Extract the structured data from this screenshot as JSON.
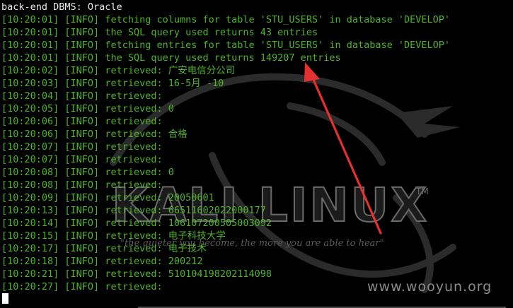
{
  "terminal": {
    "header": "back-end DBMS: Oracle",
    "lines": [
      {
        "ts": "[10:20:01]",
        "level": "[INFO]",
        "msg": "fetching columns for table 'STU_USERS' in database 'DEVELOP'"
      },
      {
        "ts": "[10:20:01]",
        "level": "[INFO]",
        "msg": "the SQL query used returns 43 entries"
      },
      {
        "ts": "[10:20:01]",
        "level": "[INFO]",
        "msg": "fetching entries for table 'STU_USERS' in database 'DEVELOP'"
      },
      {
        "ts": "[10:20:01]",
        "level": "[INFO]",
        "msg": "the SQL query used returns 149207 entries"
      },
      {
        "ts": "[10:20:02]",
        "level": "[INFO]",
        "msg": "retrieved: 广安电信分公司"
      },
      {
        "ts": "[10:20:03]",
        "level": "[INFO]",
        "msg": "retrieved: 16-5月 -10"
      },
      {
        "ts": "[10:20:04]",
        "level": "[INFO]",
        "msg": "retrieved:"
      },
      {
        "ts": "[10:20:05]",
        "level": "[INFO]",
        "msg": "retrieved: 0"
      },
      {
        "ts": "[10:20:06]",
        "level": "[INFO]",
        "msg": "retrieved:"
      },
      {
        "ts": "[10:20:06]",
        "level": "[INFO]",
        "msg": "retrieved: 合格"
      },
      {
        "ts": "[10:20:07]",
        "level": "[INFO]",
        "msg": "retrieved:"
      },
      {
        "ts": "[10:20:07]",
        "level": "[INFO]",
        "msg": "retrieved:"
      },
      {
        "ts": "[10:20:08]",
        "level": "[INFO]",
        "msg": "retrieved: 0"
      },
      {
        "ts": "[10:20:08]",
        "level": "[INFO]",
        "msg": "retrieved:"
      },
      {
        "ts": "[10:20:09]",
        "level": "[INFO]",
        "msg": "retrieved: 20050601"
      },
      {
        "ts": "[10:20:13]",
        "level": "[INFO]",
        "msg": "retrieved: 66511602022000177"
      },
      {
        "ts": "[10:20:14]",
        "level": "[INFO]",
        "msg": "retrieved: 106107200505003092"
      },
      {
        "ts": "[10:20:15]",
        "level": "[INFO]",
        "msg": "retrieved: 电子科技大学"
      },
      {
        "ts": "[10:20:17]",
        "level": "[INFO]",
        "msg": "retrieved: 电子技术"
      },
      {
        "ts": "[10:20:18]",
        "level": "[INFO]",
        "msg": "retrieved: 200212"
      },
      {
        "ts": "[10:20:21]",
        "level": "[INFO]",
        "msg": "retrieved: 510104198202114098"
      },
      {
        "ts": "[10:20:27]",
        "level": "[INFO]",
        "msg": "retrieved:"
      }
    ]
  },
  "background": {
    "logo_text": "KALI LINUX",
    "trademark": "TM",
    "motto": "\"the quieter you become, the more you are able to hear\"",
    "watermark": "www.wooyun.org"
  },
  "colors": {
    "background": "#000000",
    "log_text": "#4fb32a",
    "header_text": "#e8e8e8",
    "annotation_arrow": "#e53030"
  },
  "icons": {
    "annotation": "red-arrow-icon",
    "cursor": "block-cursor-icon"
  }
}
